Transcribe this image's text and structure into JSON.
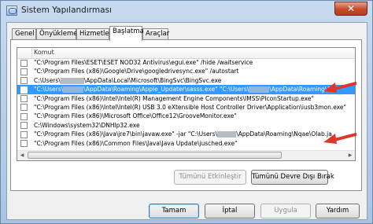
{
  "window": {
    "title": "Sistem Yapılandırması",
    "close_glyph": "✕",
    "icon": "system-configuration-icon"
  },
  "tabs": [
    {
      "label": "Genel"
    },
    {
      "label": "Önyükleme"
    },
    {
      "label": "Hizmetler"
    },
    {
      "label": "Başlatma"
    },
    {
      "label": "Araçlar"
    }
  ],
  "active_tab": "Başlatma",
  "list": {
    "column_header": "Komut",
    "rows": [
      {
        "text": "\"C:\\Program Files\\ESET\\ESET NOD32 Antivirus\\egui.exe\" /hide /waitservice",
        "checked": false,
        "selected": false
      },
      {
        "text": "\"C:\\Program Files (x86)\\Google\\Drive\\googledrivesync.exe\" /autostart",
        "checked": false,
        "selected": false
      },
      {
        "text_before": "C:\\Users\\",
        "text_after": "\\AppData\\Local\\Microsoft\\BingSvc\\BingSvc.exe",
        "checked": false,
        "selected": false
      },
      {
        "text_before": "\"C:\\Users\\",
        "text_mid": "\\AppData\\Roaming\\Apple_Updater\\sasss.exe\" \"C:\\Users\\",
        "text_after": "\\AppData\\Roaming\\Ap",
        "checked": false,
        "selected": true
      },
      {
        "text": "\"C:\\Program Files (x86)\\Intel\\Intel(R) Management Engine Components\\IMSS\\PIconStartup.exe\"",
        "checked": false,
        "selected": false
      },
      {
        "text": "\"C:\\Program Files (x86)\\Intel\\Intel(R) USB 3.0 eXtensible Host Controller Driver\\Application\\iusb3mon.exe\"",
        "checked": false,
        "selected": false
      },
      {
        "text": "\"C:\\Program Files (x86)\\Microsoft Office\\Office12\\GrooveMonitor.exe\"",
        "checked": false,
        "selected": false
      },
      {
        "text": "C:\\Windows\\system32\\DNHlp32.exe",
        "checked": false,
        "selected": false
      },
      {
        "text_before": "\"C:\\Program Files (x86)\\Java\\jre7\\bin\\javaw.exe\" -jar \"C:\\Users\\",
        "text_after": "\\AppData\\Roaming\\Nqae\\Olab.ja",
        "checked": false,
        "selected": false
      },
      {
        "text": "\"C:\\Program Files (x86)\\Common Files\\Java\\Java Update\\jusched.exe\"",
        "checked": false,
        "selected": false
      }
    ]
  },
  "panel_buttons": {
    "enable_all": "Tümünü Etkinleştir",
    "disable_all": "Tümünü Devre Dışı Bırak"
  },
  "dialog_buttons": {
    "ok": "Tamam",
    "cancel": "İptal",
    "apply": "Uygula",
    "help": "Yardım"
  },
  "colors": {
    "selection": "#3399ff",
    "annotation_arrow": "#e0352b",
    "close_button": "#c64a2a"
  }
}
